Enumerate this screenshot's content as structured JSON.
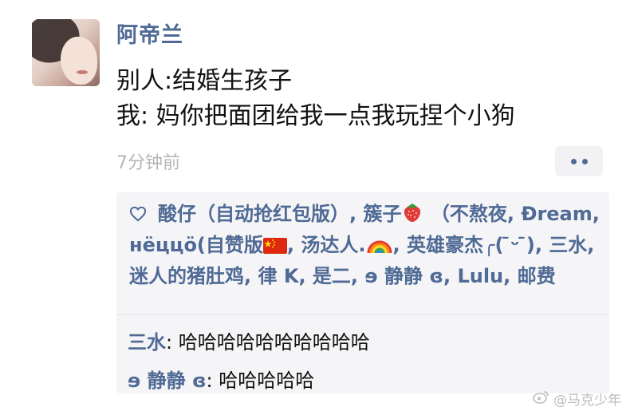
{
  "post": {
    "username": "阿帝兰",
    "line1": "别人:结婚生孩子",
    "line2": "我: 妈你把面团给我一点我玩捏个小狗",
    "timestamp": "7分钟前"
  },
  "likes": {
    "names": [
      "酸仔（自动抢红包版）",
      "簇子",
      "（不熬夜,",
      "Đream",
      "нёццö(自赞版",
      "汤达人.",
      "英雄豪杰╭( ̄ᵕ ̄)",
      "三水",
      "迷人的猪肚鸡",
      "律 K",
      "是二",
      "ɘ 静静 ɞ",
      "Lulu",
      "邮费"
    ],
    "sep": ", "
  },
  "comments": [
    {
      "author": "三水",
      "text": "哈哈哈哈哈哈哈哈哈哈"
    },
    {
      "author": "ɘ 静静 ɞ",
      "text": "哈哈哈哈哈"
    }
  ],
  "watermark": "@马克少年",
  "icons": {
    "heart": "heart-outline-icon",
    "strawberry": "strawberry-icon",
    "flag": "china-flag-icon",
    "rainbow": "rainbow-icon",
    "more": "more-dots-icon",
    "weibo": "weibo-logo-icon"
  },
  "colors": {
    "link": "#4f6a95",
    "timestamp": "#b6b6b6",
    "panel_bg": "#f5f5f7"
  }
}
